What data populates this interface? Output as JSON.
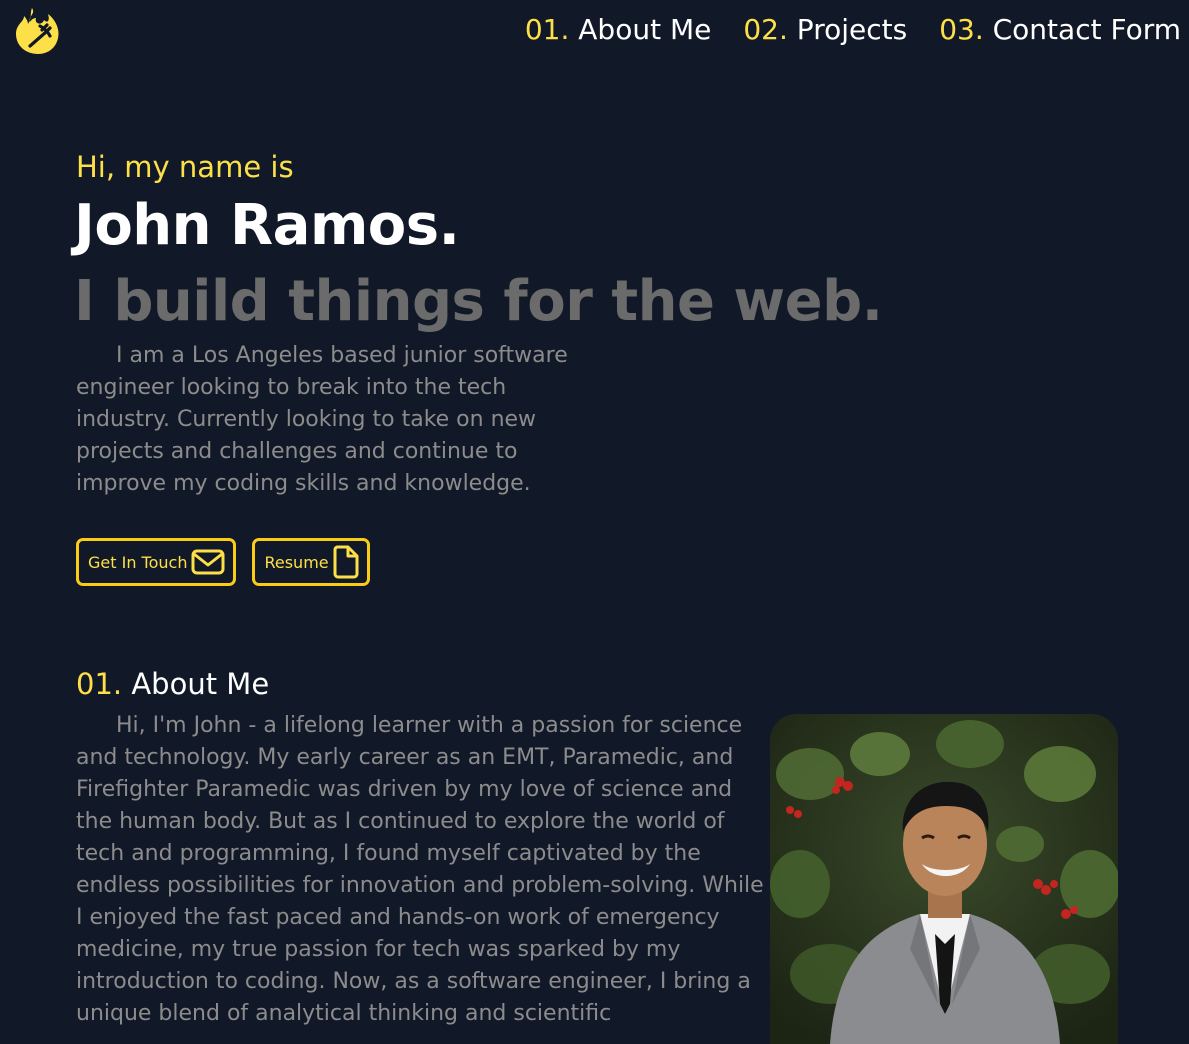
{
  "nav": {
    "links": [
      {
        "num": "01.",
        "label": "About Me"
      },
      {
        "num": "02.",
        "label": "Projects"
      },
      {
        "num": "03.",
        "label": "Contact Form"
      }
    ]
  },
  "hero": {
    "greeting": "Hi, my name is",
    "name": "John Ramos.",
    "tagline": "I build things for the web.",
    "intro": "I am a Los Angeles based junior software engineer looking to break into the tech industry. Currently looking to take on new projects and challenges and continue to improve my coding skills and knowledge.",
    "buttons": {
      "contact_label": "Get In Touch",
      "resume_label": "Resume"
    }
  },
  "about": {
    "num": "01.",
    "title": "About Me",
    "body": "Hi, I'm John - a lifelong learner with a passion for science and technology. My early career as an EMT, Paramedic, and Firefighter Paramedic was driven by my love of science and the human body. But as I continued to explore the world of tech and programming, I found myself captivated by the endless possibilities for innovation and problem-solving. While I enjoyed the fast paced and hands-on work of emergency medicine, my true passion for tech was sparked by my introduction to coding. Now, as a software engineer, I bring a unique blend of analytical thinking and scientific"
  },
  "colors": {
    "background": "#111827",
    "accent": "#fde047",
    "heading": "#ffffff",
    "muted": "#6b6b6b",
    "body_text": "#8c8c8c"
  },
  "icons": {
    "logo": "flame-pitchfork-logo-icon",
    "contact": "envelope-icon",
    "resume": "document-icon"
  }
}
